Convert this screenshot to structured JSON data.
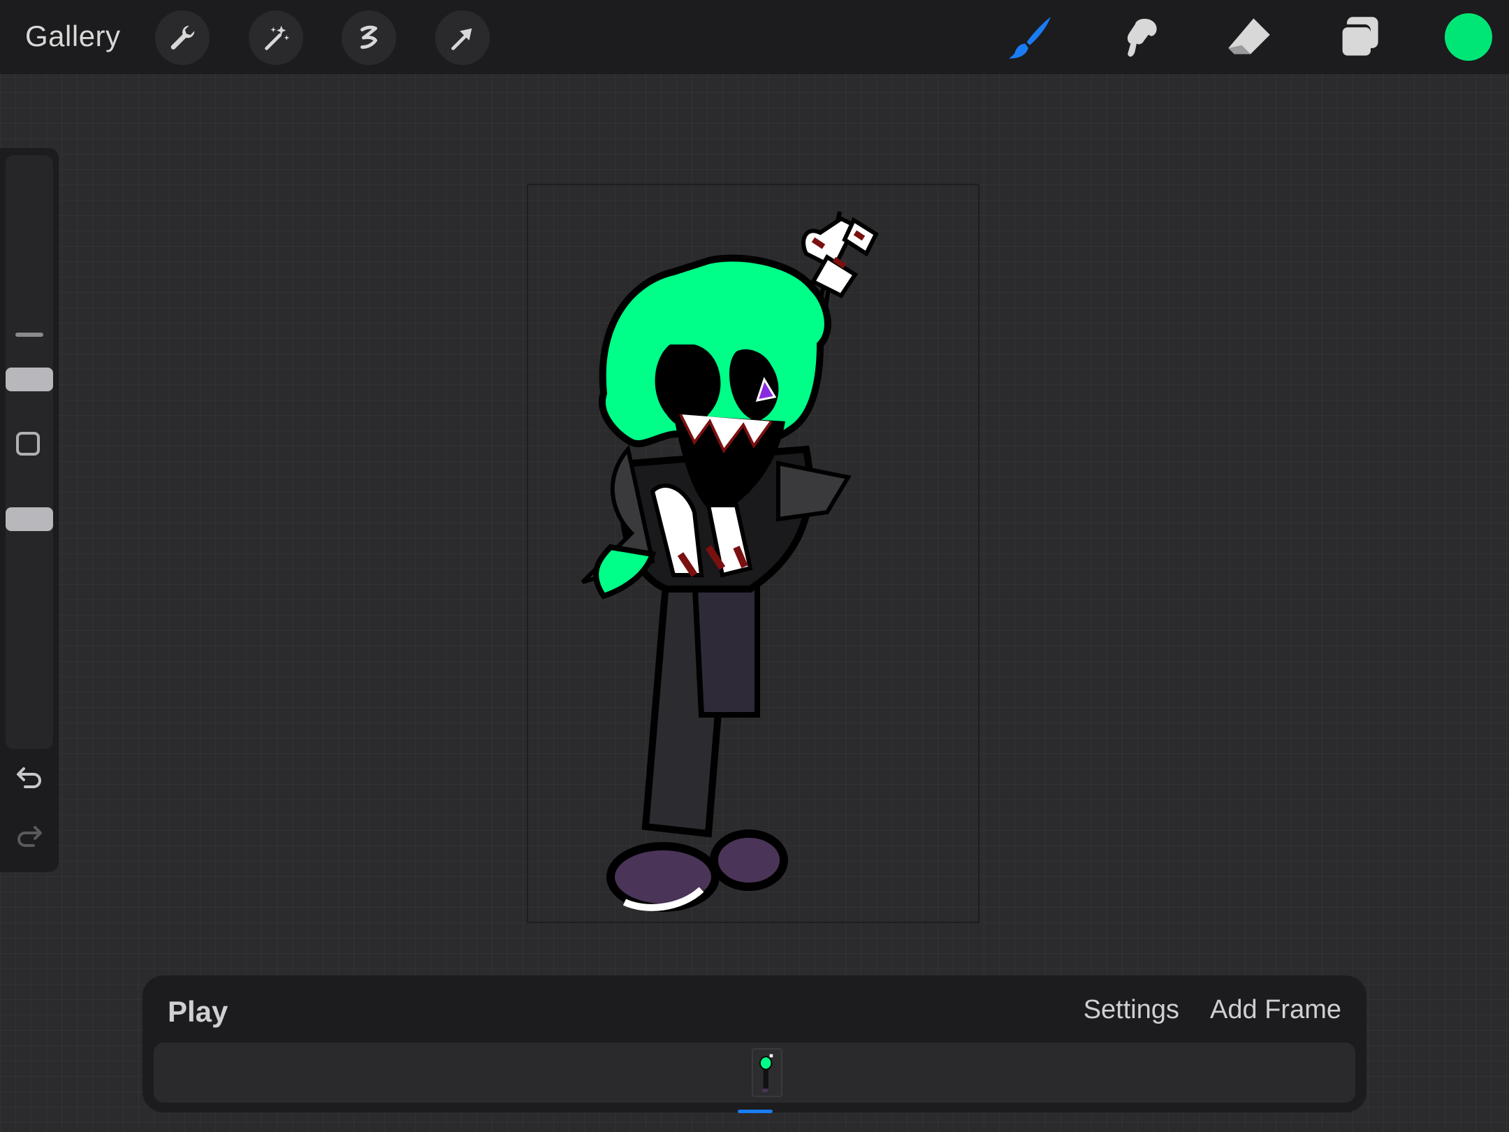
{
  "topbar": {
    "gallery_label": "Gallery",
    "left_tools": [
      {
        "name": "wrench-icon",
        "label": "Actions"
      },
      {
        "name": "magic-wand-icon",
        "label": "Adjustments"
      },
      {
        "name": "selection-icon",
        "label": "Selection"
      },
      {
        "name": "transform-arrow-icon",
        "label": "Transform"
      }
    ],
    "right_tools": [
      {
        "name": "brush-icon",
        "label": "Paint",
        "active": true
      },
      {
        "name": "smudge-icon",
        "label": "Smudge",
        "active": false
      },
      {
        "name": "eraser-icon",
        "label": "Erase",
        "active": false
      },
      {
        "name": "layers-icon",
        "label": "Layers",
        "active": false
      }
    ],
    "current_color": "#00e676"
  },
  "sidebar": {
    "tools": [
      "brush-size-slider",
      "modify-button",
      "opacity-slider",
      "undo-icon",
      "redo-icon"
    ]
  },
  "animation": {
    "play_label": "Play",
    "settings_label": "Settings",
    "add_frame_label": "Add Frame",
    "frame_count": 1,
    "selected_frame": 1
  },
  "colors": {
    "accent": "#1a7cf5",
    "brand_green": "#00ff88",
    "toolbar_bg": "#1c1c1e",
    "canvas_bg": "#2b2b2d"
  }
}
